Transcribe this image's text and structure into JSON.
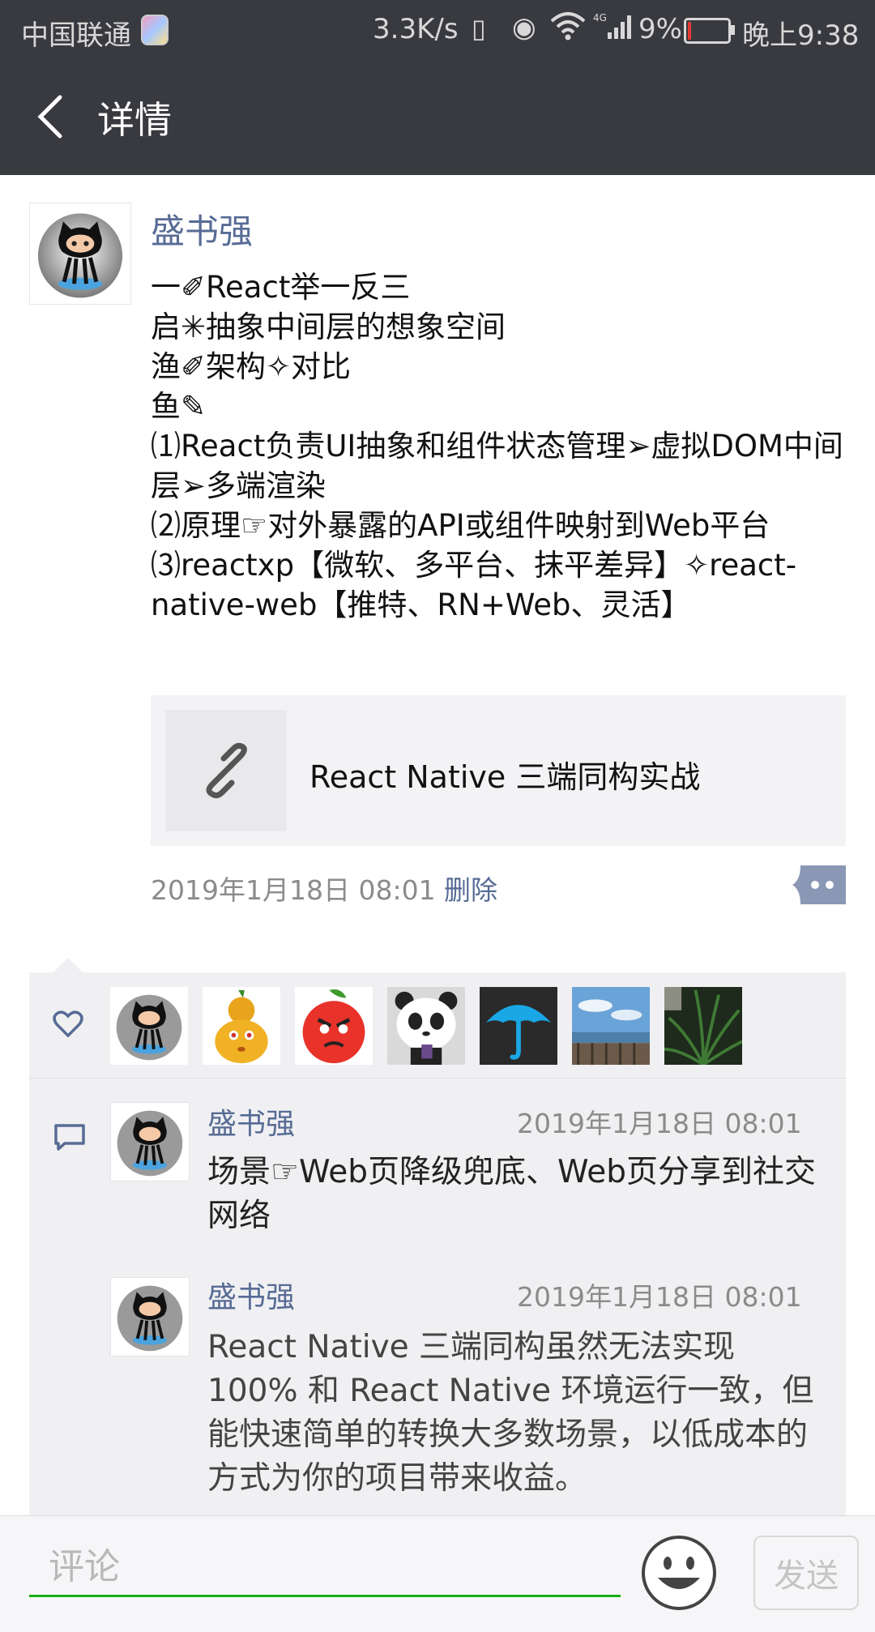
{
  "status_bar": {
    "carrier": "中国联通",
    "net_speed": "3.3K/s",
    "network_type": "4G",
    "battery_percent": "9%",
    "time": "晚上9:38",
    "battery_level": 0.09,
    "colors": {
      "background": "#393a3f",
      "battery_low": "#e53935"
    }
  },
  "header": {
    "back_icon": "chevron-left-icon",
    "title": "详情",
    "background": "#393a3f"
  },
  "post": {
    "author": "盛书强",
    "avatar_icon": "octocat-avatar",
    "body": "一✐React举一反三\n启✳抽象中间层的想象空间\n渔✐架构✧对比\n鱼✎\n⑴React负责UI抽象和组件状态管理➢虚拟DOM中间层➢多端渲染\n⑵原理☞对外暴露的API或组件映射到Web平台\n⑶reactxp【微软、多平台、抹平差异】✧react-native-web【推特、RN+Web、灵活】",
    "link": {
      "icon": "link-icon",
      "title": "React Native 三端同构实战"
    },
    "timestamp": "2019年1月18日 08:01",
    "delete_label": "删除",
    "more_icon": "more-dots-icon",
    "name_color": "#576b95"
  },
  "likes": {
    "icon": "heart-icon",
    "avatars": [
      {
        "name": "octocat-avatar"
      },
      {
        "name": "gourd-avatar"
      },
      {
        "name": "angry-apple-avatar"
      },
      {
        "name": "panda-avatar"
      },
      {
        "name": "umbrella-avatar"
      },
      {
        "name": "sea-photo-avatar"
      },
      {
        "name": "plant-photo-avatar"
      }
    ]
  },
  "comments": {
    "icon": "comment-icon",
    "items": [
      {
        "author": "盛书强",
        "time": "2019年1月18日 08:01",
        "text": "场景☞Web页降级兜底、Web页分享到社交网络"
      },
      {
        "author": "盛书强",
        "time": "2019年1月18日 08:01",
        "text": "React Native 三端同构虽然无法实现 100% 和 React Native 环境运行一致，但能快速简单的转换大多数场景，以低成本的方式为你的项目带来收益。"
      }
    ]
  },
  "input_bar": {
    "placeholder": "评论",
    "emoji_icon": "emoji-icon",
    "send_label": "发送",
    "accent": "#1aad19"
  }
}
